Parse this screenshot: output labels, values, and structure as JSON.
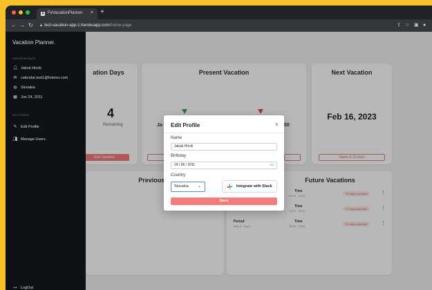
{
  "browser": {
    "tab_title": "FeVacationPlanner",
    "tab_favicon": "A",
    "new_tab": "+",
    "url_host": "test-vacation-app-1.herokuapp.com",
    "url_path": "/home-page",
    "icons": [
      "back-arrow-icon",
      "forward-arrow-icon",
      "reload-icon",
      "lock-icon",
      "share-icon",
      "star-icon",
      "sidebar-toggle-icon",
      "profile-icon"
    ]
  },
  "sidebar": {
    "brand": "Vacation Planner.",
    "credentials_heading": "CREDENTIALS",
    "credentials": [
      {
        "icon": "user-icon",
        "text": "Jakub Hricik"
      },
      {
        "icon": "mail-icon",
        "text": "calendar.test1@hotovo.com"
      },
      {
        "icon": "globe-icon",
        "text": "Slovakia"
      },
      {
        "icon": "calendar-icon",
        "text": "Jun 24, 2011"
      }
    ],
    "settings_heading": "SETTINGS",
    "settings": [
      {
        "icon": "edit-user-icon",
        "text": "Edit Profile"
      },
      {
        "icon": "users-icon",
        "text": "Manage Users"
      }
    ],
    "logout": "LogOut"
  },
  "dashboard": {
    "days_card": {
      "title": "ation Days",
      "number": "4",
      "label": "Remaining",
      "button": "New Vacation"
    },
    "present_card": {
      "title": "Present Vacation",
      "left_text": "Ja",
      "right_text": "00"
    },
    "next_card": {
      "title": "Next Vacation",
      "date": "Feb 16, 2023",
      "button": "Starts in 23 days"
    },
    "previous_card": {
      "title": "Previous Vacation"
    },
    "future_card": {
      "title": "Future Vacations",
      "rows": [
        {
          "period_label": "",
          "period": "",
          "time_label": "Time",
          "time": "08:00 - 16:00",
          "badge": "32 days until start"
        },
        {
          "period_label": "",
          "period": "",
          "time_label": "Time",
          "time": "13:00 - 13:00",
          "badge": "77 days until start"
        },
        {
          "period_label": "Period",
          "period": "May 5 - May 9",
          "time_label": "Time",
          "time": "08:00 - 16:00",
          "badge": "97 days until start"
        }
      ]
    }
  },
  "modal": {
    "title": "Edit Profile",
    "close": "×",
    "name_label": "Name",
    "name_value": "Jakub Hricik",
    "birthday_label": "Birthday",
    "birthday_value": "24 / 06 / 2011",
    "country_label": "Country",
    "country_value": "Slovakia",
    "slack_button": "Integrate with Slack",
    "save_button": "Save"
  },
  "colors": {
    "accent": "#f27c7c",
    "sidebar_bg": "#0e1116",
    "focus_outline": "#4b8bd6",
    "page_border": "#f6c02a"
  }
}
